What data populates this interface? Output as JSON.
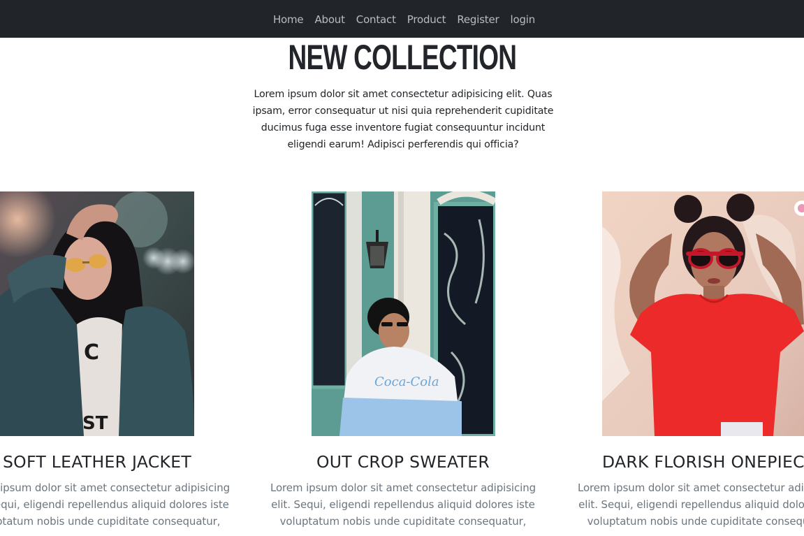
{
  "nav": {
    "items": [
      {
        "label": "Home"
      },
      {
        "label": "About"
      },
      {
        "label": "Contact"
      },
      {
        "label": "Product"
      },
      {
        "label": "Register"
      },
      {
        "label": "login"
      }
    ]
  },
  "hero": {
    "title": "NEW COLLECTION",
    "description": "Lorem ipsum dolor sit amet consectetur adipisicing elit. Quas ipsam, error consequatur ut nisi quia reprehenderit cupiditate ducimus fuga esse inventore fugiat consequuntur incidunt eligendi earum! Adipisci perferendis qui officia?"
  },
  "products": [
    {
      "title": "SOFT LEATHER JACKET",
      "description": "Lorem ipsum dolor sit amet consectetur adipisicing elit. Sequi, eligendi repellendus aliquid dolores iste voluptatum nobis unde cupiditate consequatur,"
    },
    {
      "title": "OUT CROP SWEATER",
      "description": "Lorem ipsum dolor sit amet consectetur adipisicing elit. Sequi, eligendi repellendus aliquid dolores iste voluptatum nobis unde cupiditate consequatur,",
      "shirt_text": "Coca-Cola"
    },
    {
      "title": "DARK FLORISH ONEPIECE",
      "description": "Lorem ipsum dolor sit amet consectetur adipisicing elit. Sequi, eligendi repellendus aliquid dolores iste voluptatum nobis unde cupiditate consequatur,"
    }
  ],
  "colors": {
    "navbar_bg": "#212529",
    "nav_link": "#b8bcc0",
    "heading": "#212529",
    "muted_text": "#6c757d"
  }
}
